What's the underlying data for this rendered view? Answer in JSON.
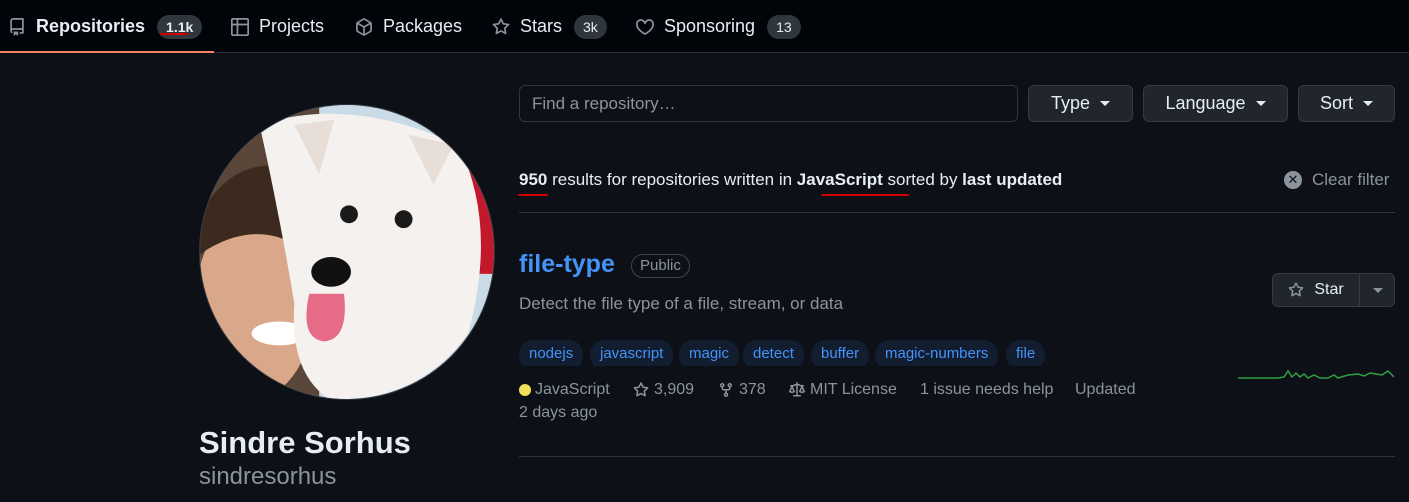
{
  "nav": {
    "tabs": [
      {
        "label": "Repositories",
        "count": "1.1k"
      },
      {
        "label": "Projects"
      },
      {
        "label": "Packages"
      },
      {
        "label": "Stars",
        "count": "3k"
      },
      {
        "label": "Sponsoring",
        "count": "13"
      }
    ]
  },
  "profile": {
    "name": "Sindre Sorhus",
    "login": "sindresorhus"
  },
  "filters": {
    "search_placeholder": "Find a repository…",
    "type_label": "Type",
    "language_label": "Language",
    "sort_label": "Sort"
  },
  "results": {
    "count": "950",
    "text1": " results for repositories written in ",
    "language": "JavaScript",
    "text2": " sorted by ",
    "sort": "last updated",
    "clear_label": "Clear filter"
  },
  "repo": {
    "name": "file-type",
    "visibility": "Public",
    "description": "Detect the file type of a file, stream, or data",
    "topics": [
      "nodejs",
      "javascript",
      "magic",
      "detect",
      "buffer",
      "magic-numbers",
      "file"
    ],
    "language": "JavaScript",
    "language_color": "#f1e05a",
    "stars": "3,909",
    "forks": "378",
    "license": "MIT License",
    "issues": "1 issue needs help",
    "updated_label": "Updated",
    "updated_value": "2 days ago",
    "star_button_label": "Star"
  },
  "colors": {
    "accent_link": "#4493f8",
    "active_tab_underline": "#f78166",
    "annotation_red": "#d10000",
    "sparkline": "#2ea043"
  }
}
